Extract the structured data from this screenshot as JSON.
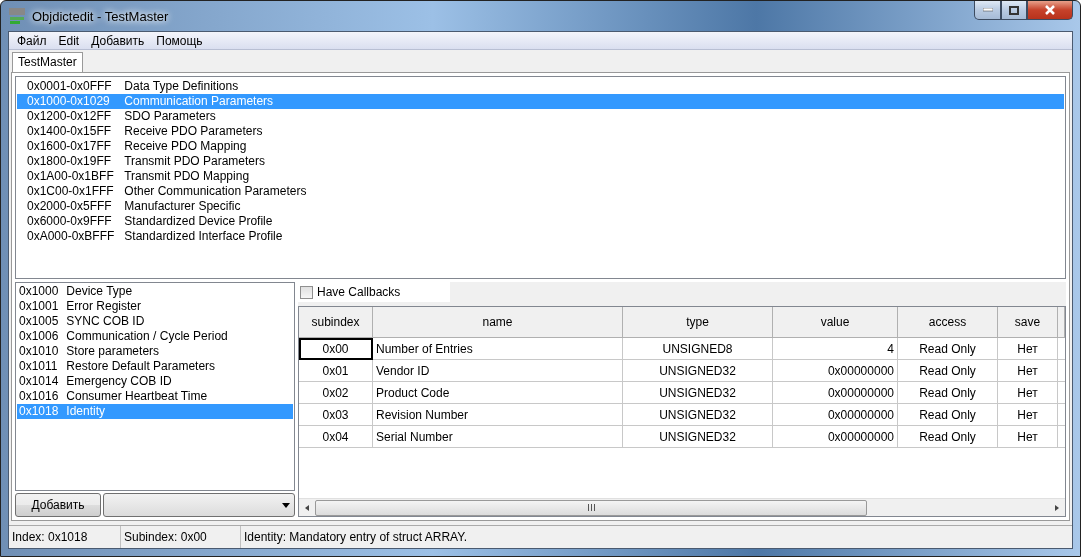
{
  "window": {
    "title": "Objdictedit - TestMaster"
  },
  "menu": [
    "Файл",
    "Edit",
    "Добавить",
    "Помощь"
  ],
  "tabs": [
    {
      "label": "TestMaster",
      "selected": true
    }
  ],
  "ranges": [
    {
      "range": "0x0001-0x0FFF",
      "name": "Data Type Definitions",
      "selected": false
    },
    {
      "range": "0x1000-0x1029",
      "name": "Communication Parameters",
      "selected": true
    },
    {
      "range": "0x1200-0x12FF",
      "name": "SDO Parameters",
      "selected": false
    },
    {
      "range": "0x1400-0x15FF",
      "name": "Receive PDO Parameters",
      "selected": false
    },
    {
      "range": "0x1600-0x17FF",
      "name": "Receive PDO Mapping",
      "selected": false
    },
    {
      "range": "0x1800-0x19FF",
      "name": "Transmit PDO Parameters",
      "selected": false
    },
    {
      "range": "0x1A00-0x1BFF",
      "name": "Transmit PDO Mapping",
      "selected": false
    },
    {
      "range": "0x1C00-0x1FFF",
      "name": "Other Communication Parameters",
      "selected": false
    },
    {
      "range": "0x2000-0x5FFF",
      "name": "Manufacturer Specific",
      "selected": false
    },
    {
      "range": "0x6000-0x9FFF",
      "name": "Standardized Device Profile",
      "selected": false
    },
    {
      "range": "0xA000-0xBFFF",
      "name": "Standardized Interface Profile",
      "selected": false
    }
  ],
  "indexes": [
    {
      "index": "0x1000",
      "name": "Device Type",
      "selected": false
    },
    {
      "index": "0x1001",
      "name": "Error Register",
      "selected": false
    },
    {
      "index": "0x1005",
      "name": "SYNC COB ID",
      "selected": false
    },
    {
      "index": "0x1006",
      "name": "Communication / Cycle Period",
      "selected": false
    },
    {
      "index": "0x1010",
      "name": "Store parameters",
      "selected": false
    },
    {
      "index": "0x1011",
      "name": "Restore Default Parameters",
      "selected": false
    },
    {
      "index": "0x1014",
      "name": "Emergency COB ID",
      "selected": false
    },
    {
      "index": "0x1016",
      "name": "Consumer Heartbeat Time",
      "selected": false
    },
    {
      "index": "0x1018",
      "name": "Identity",
      "selected": true
    }
  ],
  "add_button": "Добавить",
  "callbacks": {
    "label": "Have Callbacks",
    "checked": false
  },
  "table": {
    "columns": [
      "subindex",
      "name",
      "type",
      "value",
      "access",
      "save"
    ],
    "rows": [
      {
        "cells": [
          "0x00",
          "Number of Entries",
          "UNSIGNED8",
          "4",
          "Read Only",
          "Нет"
        ],
        "focused": true
      },
      {
        "cells": [
          "0x01",
          "Vendor ID",
          "UNSIGNED32",
          "0x00000000",
          "Read Only",
          "Нет"
        ],
        "focused": false
      },
      {
        "cells": [
          "0x02",
          "Product Code",
          "UNSIGNED32",
          "0x00000000",
          "Read Only",
          "Нет"
        ],
        "focused": false
      },
      {
        "cells": [
          "0x03",
          "Revision Number",
          "UNSIGNED32",
          "0x00000000",
          "Read Only",
          "Нет"
        ],
        "focused": false
      },
      {
        "cells": [
          "0x04",
          "Serial Number",
          "UNSIGNED32",
          "0x00000000",
          "Read Only",
          "Нет"
        ],
        "focused": false
      }
    ]
  },
  "status_bar": [
    "Index: 0x1018",
    "Subindex: 0x00",
    "Identity: Mandatory entry of struct ARRAY."
  ]
}
